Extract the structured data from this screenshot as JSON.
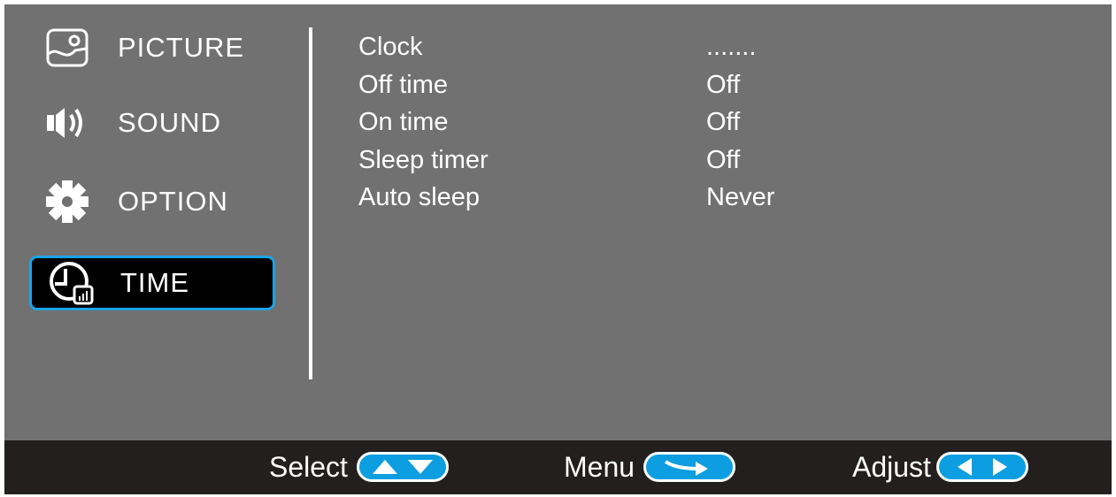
{
  "sidebar": {
    "items": [
      {
        "label": "PICTURE",
        "icon": "picture-icon"
      },
      {
        "label": "SOUND",
        "icon": "speaker-icon"
      },
      {
        "label": "OPTION",
        "icon": "gear-icon"
      },
      {
        "label": "TIME",
        "icon": "clock-icon",
        "selected": true
      }
    ]
  },
  "settings": [
    {
      "name": "Clock",
      "value": "......."
    },
    {
      "name": "Off time",
      "value": "Off"
    },
    {
      "name": "On time",
      "value": "Off"
    },
    {
      "name": "Sleep timer",
      "value": "Off"
    },
    {
      "name": "Auto sleep",
      "value": "Never"
    }
  ],
  "footer": {
    "select_label": "Select",
    "menu_label": "Menu",
    "adjust_label": "Adjust"
  },
  "colors": {
    "background": "#717171",
    "footer": "#231f1f",
    "accent": "#0c9ee0",
    "selected_border": "#1ba3e6"
  }
}
